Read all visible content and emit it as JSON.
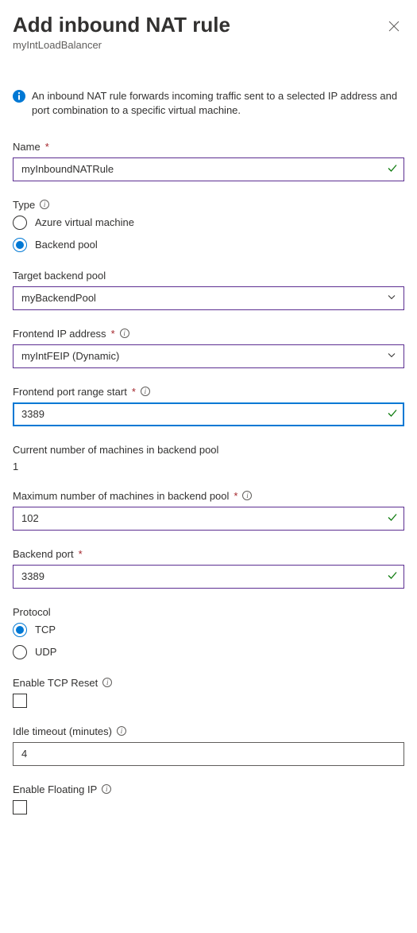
{
  "header": {
    "title": "Add inbound NAT rule",
    "subtitle": "myIntLoadBalancer"
  },
  "info": {
    "text": "An inbound NAT rule forwards incoming traffic sent to a selected IP address and port combination to a specific virtual machine."
  },
  "name_field": {
    "label": "Name",
    "value": "myInboundNATRule"
  },
  "type_field": {
    "label": "Type",
    "options": {
      "vm": "Azure virtual machine",
      "pool": "Backend pool"
    },
    "selected": "pool"
  },
  "target_pool": {
    "label": "Target backend pool",
    "value": "myBackendPool"
  },
  "frontend_ip": {
    "label": "Frontend IP address",
    "value": "myIntFEIP (Dynamic)"
  },
  "port_start": {
    "label": "Frontend port range start",
    "value": "3389"
  },
  "current_machines": {
    "label": "Current number of machines in backend pool",
    "value": "1"
  },
  "max_machines": {
    "label": "Maximum number of machines in backend pool",
    "value": "102"
  },
  "backend_port": {
    "label": "Backend port",
    "value": "3389"
  },
  "protocol": {
    "label": "Protocol",
    "options": {
      "tcp": "TCP",
      "udp": "UDP"
    },
    "selected": "tcp"
  },
  "tcp_reset": {
    "label": "Enable TCP Reset",
    "checked": false
  },
  "idle_timeout": {
    "label": "Idle timeout (minutes)",
    "value": "4"
  },
  "floating_ip": {
    "label": "Enable Floating IP",
    "checked": false
  }
}
